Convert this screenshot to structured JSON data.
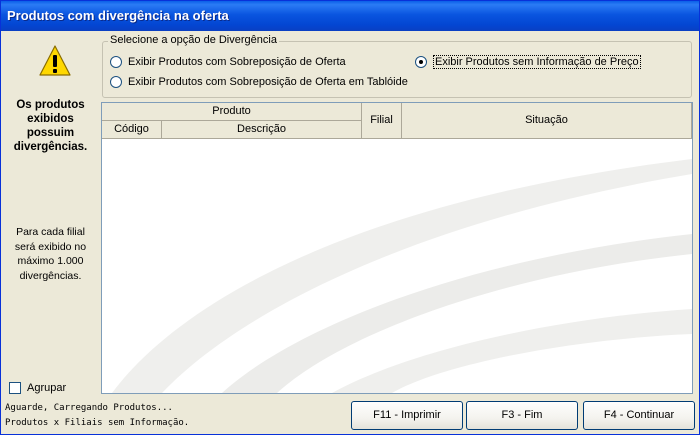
{
  "window": {
    "title": "Produtos com divergência na oferta"
  },
  "sidebar": {
    "warning_title": [
      "Os produtos",
      "exibidos",
      "possuim",
      "divergências."
    ],
    "note": [
      "Para cada filial",
      "será exibido no",
      "máximo 1.000",
      "divergências."
    ],
    "agrupar_label": "Agrupar",
    "agrupar_checked": false
  },
  "divergence_options": {
    "legend": "Selecione a opção de Divergência",
    "options": [
      {
        "label": "Exibir Produtos com Sobreposição de Oferta",
        "selected": false
      },
      {
        "label": "Exibir Produtos com Sobreposição de Oferta em Tablóide",
        "selected": false
      },
      {
        "label": "Exibir Produtos sem Informação de Preço",
        "selected": true
      }
    ]
  },
  "grid": {
    "group_header": "Produto",
    "columns": [
      "Código",
      "Descrição",
      "Filial",
      "Situação"
    ],
    "rows": []
  },
  "status": {
    "line1": "Aguarde, Carregando Produtos...",
    "line2": "Produtos x Filiais sem Informação."
  },
  "buttons": {
    "print": "F11 - Imprimir",
    "end": "F3 - Fim",
    "continue": "F4 - Continuar"
  },
  "colors": {
    "titlebar": "#0346d2",
    "window_bg": "#ece9d8",
    "warning_yellow": "#ffd800"
  }
}
